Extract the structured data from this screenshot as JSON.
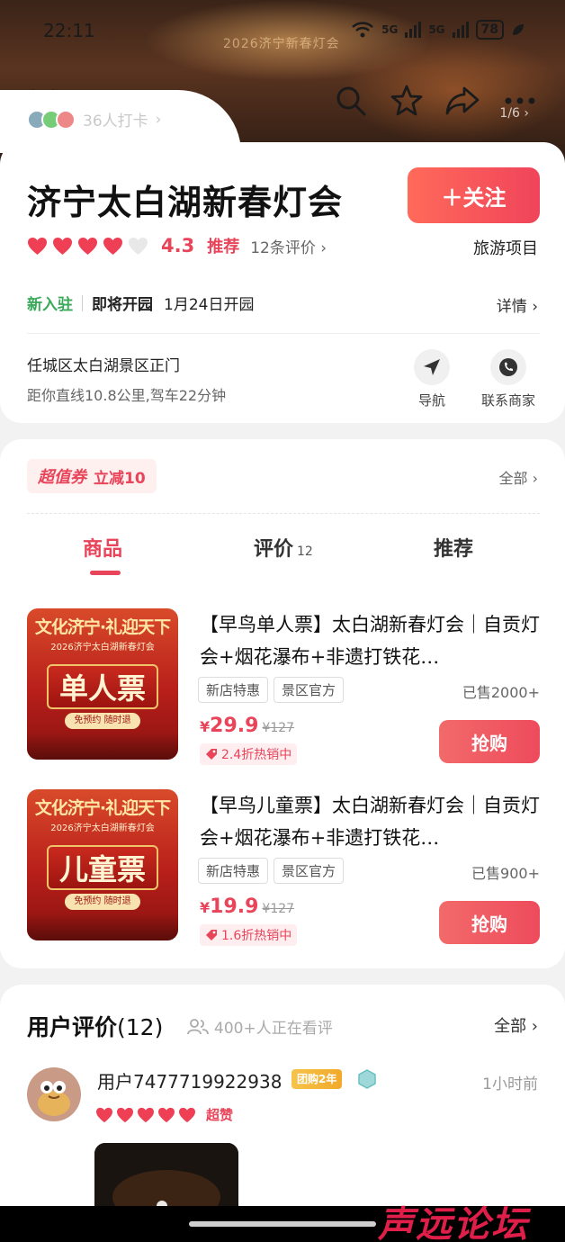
{
  "status_bar": {
    "time": "22:11",
    "net1": "5G",
    "net2": "5G",
    "battery": "78"
  },
  "hero": {
    "banner_text": "2026济宁新春灯会",
    "image_counter": "1/6",
    "checkin_text": "36人打卡"
  },
  "header": {
    "title": "济宁太白湖新春灯会",
    "follow_label": "＋关注"
  },
  "rating": {
    "hearts_filled": 4,
    "hearts_total": 5,
    "score": "4.3",
    "tag": "推荐",
    "review_count": "12条评价",
    "category": "旅游项目"
  },
  "open_info": {
    "new_tag": "新入驻",
    "status": "即将开园",
    "date": "1月24日开园",
    "detail_label": "详情"
  },
  "address": {
    "line": "任城区太白湖景区正门",
    "distance": "距你直线10.8公里,驾车22分钟",
    "nav_label": "导航",
    "contact_label": "联系商家"
  },
  "coupon": {
    "badge": "超值券",
    "text": "立减10",
    "all_label": "全部"
  },
  "tabs": [
    {
      "label": "商品",
      "count": ""
    },
    {
      "label": "评价",
      "count": "12"
    },
    {
      "label": "推荐",
      "count": ""
    }
  ],
  "products": [
    {
      "img_header": "文化济宁·礼迎天下",
      "img_sub": "2026济宁太白湖新春灯会",
      "img_plate": "单人票",
      "img_tag": "免预约 随时退",
      "title": "【早鸟单人票】太白湖新春灯会｜自贡灯会+烟花瀑布+非遗打铁花…",
      "tags": [
        "新店特惠",
        "景区官方"
      ],
      "sold": "已售2000+",
      "currency": "¥",
      "price": "29.9",
      "original": "¥127",
      "hot": "2.4折热销中",
      "buy_label": "抢购"
    },
    {
      "img_header": "文化济宁·礼迎天下",
      "img_sub": "2026济宁太白湖新春灯会",
      "img_plate": "儿童票",
      "img_tag": "免预约 随时退",
      "title": "【早鸟儿童票】太白湖新春灯会｜自贡灯会+烟花瀑布+非遗打铁花…",
      "tags": [
        "新店特惠",
        "景区官方"
      ],
      "sold": "已售900+",
      "currency": "¥",
      "price": "19.9",
      "original": "¥127",
      "hot": "1.6折热销中",
      "buy_label": "抢购"
    }
  ],
  "reviews": {
    "title": "用户评价",
    "count": "(12)",
    "viewers": "400+人正在看评",
    "all_label": "全部",
    "items": [
      {
        "user": "用户7477719922938",
        "badge": "团购2年",
        "time": "1小时前",
        "hearts": 5,
        "praise": "超赞"
      }
    ]
  },
  "watermark": "声远论坛",
  "colors": {
    "accent": "#e8455a",
    "green": "#3aaa5a"
  }
}
